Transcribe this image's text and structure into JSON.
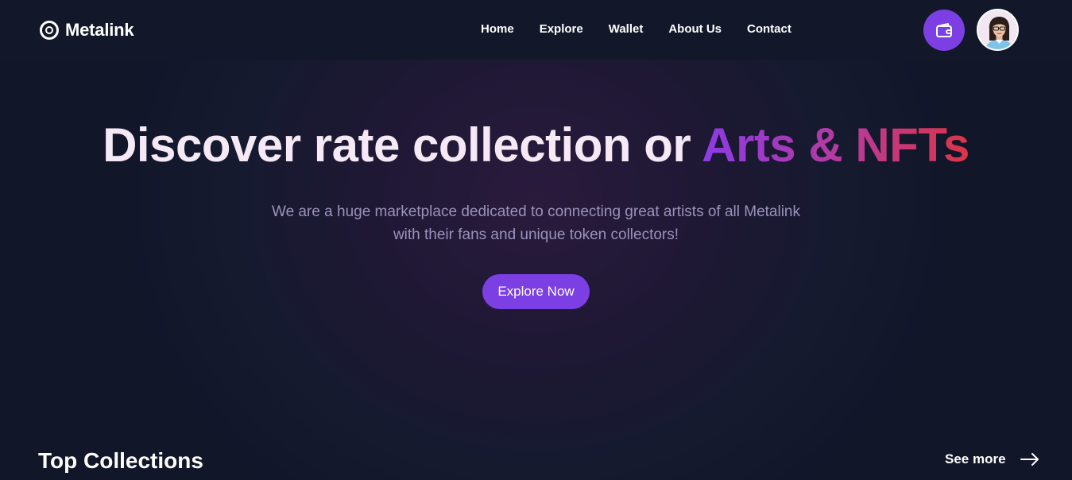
{
  "brand": {
    "name": "Metalink",
    "logo_icon": "ring-logo-icon"
  },
  "nav": {
    "items": [
      {
        "label": "Home"
      },
      {
        "label": "Explore"
      },
      {
        "label": "Wallet"
      },
      {
        "label": "About Us"
      },
      {
        "label": "Contact"
      }
    ]
  },
  "header_actions": {
    "wallet_icon": "wallet-icon",
    "avatar_icon": "user-avatar"
  },
  "hero": {
    "title_main": "Discover rate collection or ",
    "title_accent": "Arts & NFTs",
    "subtitle_line1": "We are a huge marketplace dedicated to connecting great artists of all Metalink",
    "subtitle_line2": "with their fans and unique token collectors!",
    "cta_label": "Explore Now"
  },
  "collections": {
    "title": "Top Collections",
    "see_more_label": "See more",
    "see_more_icon": "arrow-right-icon"
  },
  "colors": {
    "accent": "#7b3fe4",
    "background": "#121629",
    "gradient_start": "#8b3be6",
    "gradient_end": "#dc3545",
    "subtitle": "#9a93b9"
  }
}
